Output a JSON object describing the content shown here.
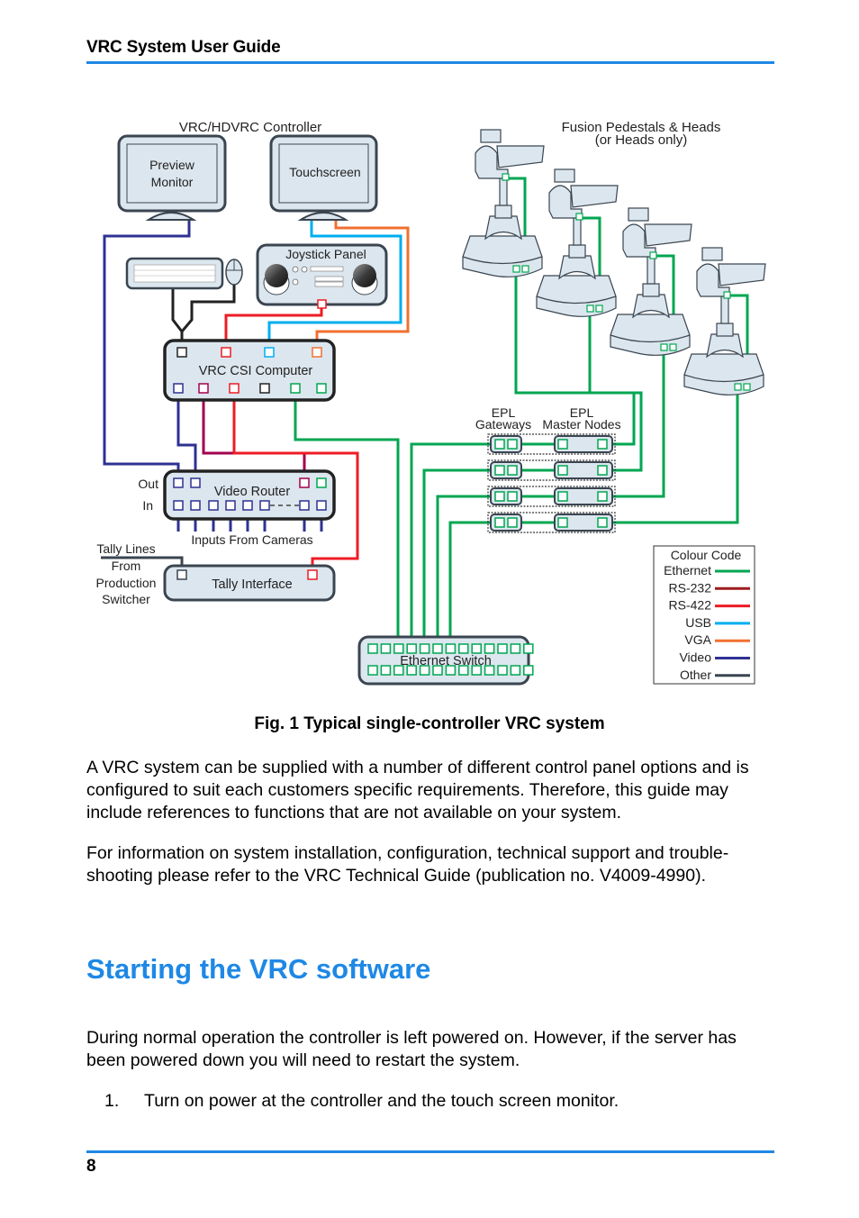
{
  "header": {
    "title": "VRC System User Guide"
  },
  "footer": {
    "page_number": "8"
  },
  "diagram": {
    "controller_label": "VRC/HDVRC Controller",
    "preview_monitor": [
      "Preview",
      "Monitor"
    ],
    "touchscreen": "Touchscreen",
    "joystick_panel": "Joystick Panel",
    "csi_computer": "VRC CSI Computer",
    "video_router": "Video Router",
    "router_out": "Out",
    "router_in": "In",
    "inputs_from_cameras": "Inputs From Cameras",
    "tally_lines": [
      "Tally Lines",
      "From",
      "Production",
      "Switcher"
    ],
    "tally_interface": "Tally Interface",
    "ethernet_switch": "Ethernet Switch",
    "pedestals_label": [
      "Fusion Pedestals & Heads",
      "(or Heads only)"
    ],
    "epl_gateways": [
      "EPL",
      "Gateways"
    ],
    "epl_master_nodes": [
      "EPL",
      "Master Nodes"
    ],
    "legend": {
      "title": "Colour Code",
      "items": [
        {
          "label": "Ethernet",
          "color": "#00a651"
        },
        {
          "label": "RS-232",
          "color": "#9e1b1e"
        },
        {
          "label": "RS-422",
          "color": "#ed1c24"
        },
        {
          "label": "USB",
          "color": "#00aeef"
        },
        {
          "label": "VGA",
          "color": "#f07030"
        },
        {
          "label": "Video",
          "color": "#2e3192"
        },
        {
          "label": "Other",
          "color": "#3a4550"
        }
      ]
    }
  },
  "figure_caption": "Fig. 1  Typical single-controller VRC system",
  "paragraphs": [
    "A VRC system can be supplied with a number of different control panel options and is configured to suit each customers specific requirements. Therefore, this guide may include references to functions that are not available on your system.",
    "For information on system installation, configuration, technical support and trouble-shooting please refer to the VRC Technical Guide (publication no. V4009-4990)."
  ],
  "section": {
    "heading": "Starting the VRC software",
    "paragraph": "During normal operation the controller is left powered on. However, if the server has been powered down you will need to restart the system.",
    "steps": [
      {
        "number": "1.",
        "text": "Turn on power at the controller and the touch screen monitor."
      }
    ]
  }
}
